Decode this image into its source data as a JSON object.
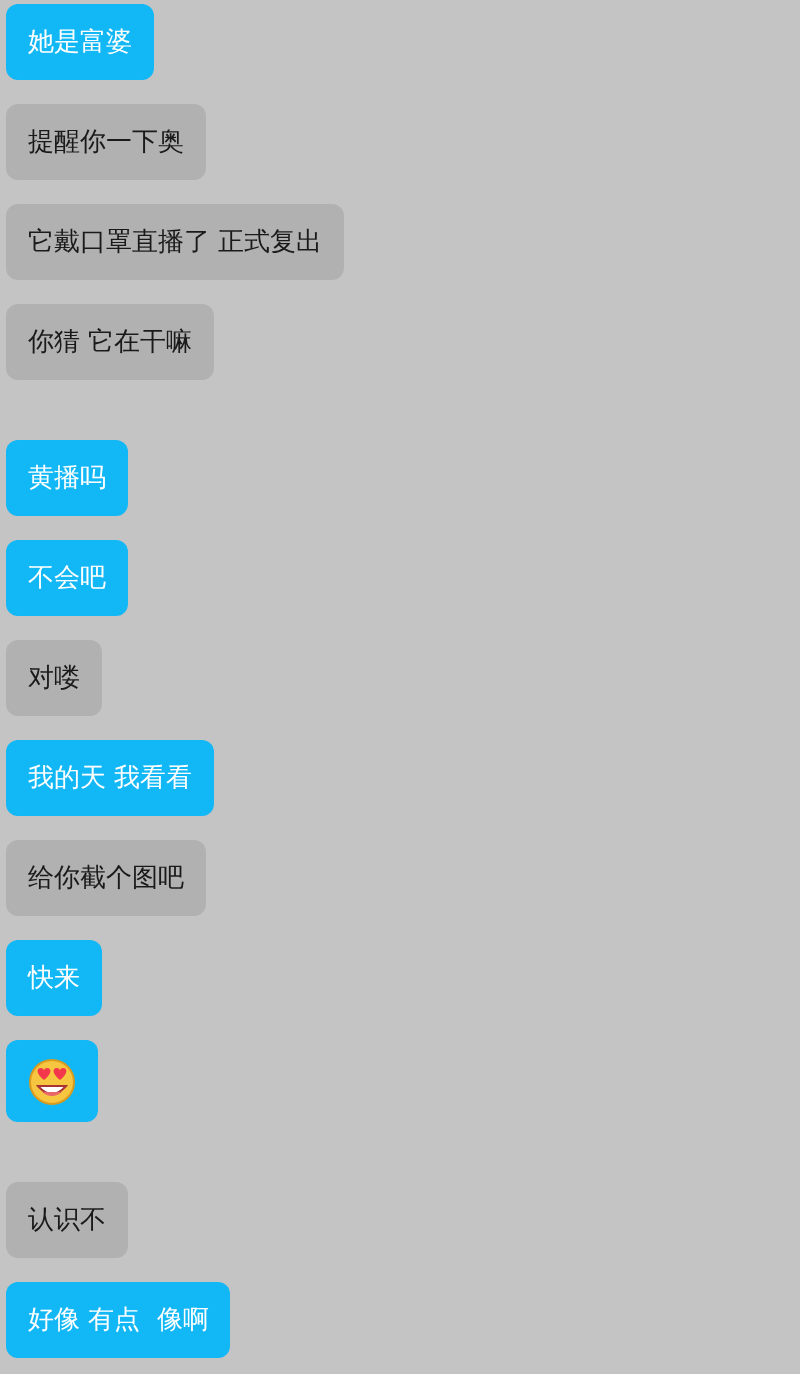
{
  "groups": [
    [
      {
        "kind": "sent",
        "text": "她是富婆"
      },
      {
        "kind": "received",
        "text": "提醒你一下奥"
      },
      {
        "kind": "received",
        "text": "它戴口罩直播了 正式复出"
      },
      {
        "kind": "received",
        "text": "你猜 它在干嘛"
      }
    ],
    [
      {
        "kind": "sent",
        "text": "黄播吗"
      },
      {
        "kind": "sent",
        "text": "不会吧"
      },
      {
        "kind": "received",
        "text": "对喽"
      },
      {
        "kind": "sent",
        "text": "我的天 我看看"
      },
      {
        "kind": "received",
        "text": "给你截个图吧"
      },
      {
        "kind": "sent",
        "text": "快来"
      },
      {
        "kind": "emoji"
      }
    ],
    [
      {
        "kind": "received",
        "text": "认识不"
      },
      {
        "kind": "sent",
        "text": "好像 有点  像啊"
      }
    ]
  ]
}
